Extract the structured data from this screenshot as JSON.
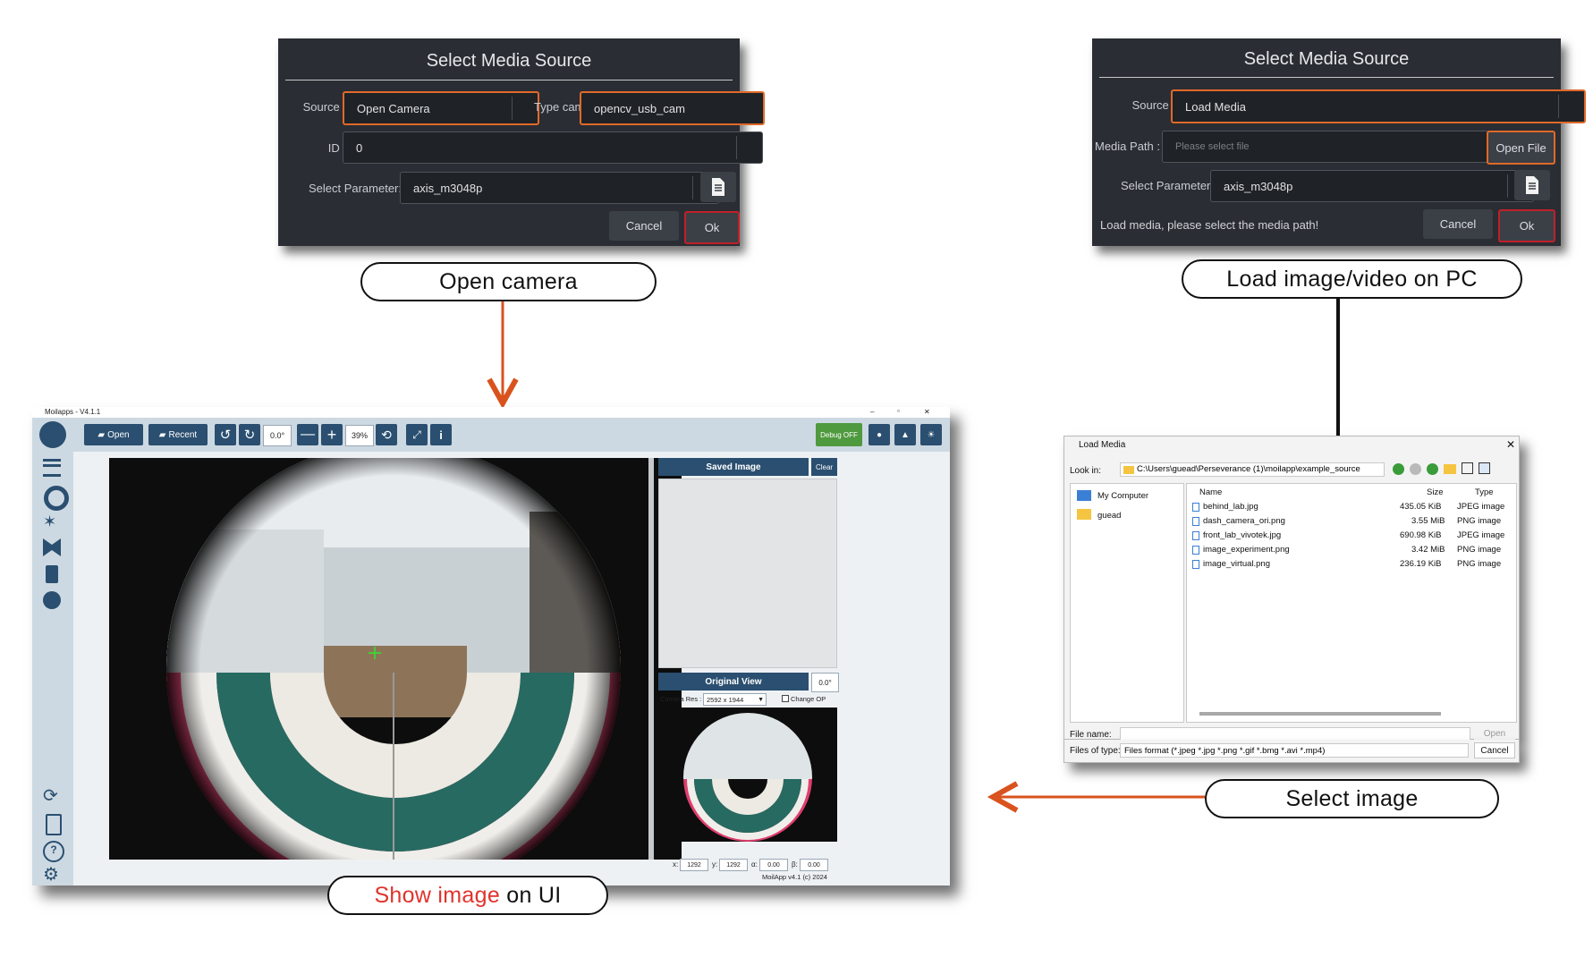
{
  "dialog_camera": {
    "title": "Select Media Source",
    "source_label": "Source :",
    "source_value": "Open Camera",
    "typecam_label": "Type cam:",
    "typecam_value": "opencv_usb_cam",
    "id_label": "ID :",
    "id_value": "0",
    "param_label": "Select Parameter:",
    "param_value": "axis_m3048p",
    "cancel": "Cancel",
    "ok": "Ok"
  },
  "dialog_load": {
    "title": "Select Media Source",
    "source_label": "Source :",
    "source_value": "Load Media",
    "path_label": "Media Path :",
    "path_placeholder": "Please select file",
    "open_file": "Open File",
    "param_label": "Select Parameter:",
    "param_value": "axis_m3048p",
    "message": "Load media, please select the media path!",
    "cancel": "Cancel",
    "ok": "Ok"
  },
  "pills": {
    "open_camera": "Open camera",
    "load": "Load image/video on PC",
    "select": "Select image",
    "show_red": "Show image",
    "show_rest": " on UI"
  },
  "app": {
    "title": "Moilapps - V4.1.1",
    "win_min": "–",
    "win_max": "▫",
    "win_close": "✕",
    "open": "Open",
    "recent": "Recent",
    "rotate_value": "0.0°",
    "zoom_value": "39%",
    "debug": "Debug OFF",
    "saved_image": "Saved Image",
    "clear": "Clear",
    "original_view": "Original View",
    "orig_angle": "0.0°",
    "camera_res_label": "Camera Res :",
    "camera_res_value": "2592 x 1944",
    "change_op": "Change OP",
    "x_label": "x:",
    "x_value": "1292",
    "y_label": "y:",
    "y_value": "1292",
    "alpha_label": "α:",
    "alpha_value": "0.00",
    "beta_label": "β:",
    "beta_value": "0.00",
    "footer": "MoilApp v4.1 (c) 2024"
  },
  "file_dialog": {
    "title": "Load Media",
    "close": "✕",
    "look_in_label": "Look in:",
    "look_in_value": "C:\\Users\\guead\\Perseverance (1)\\moilapp\\example_source",
    "places": [
      "My Computer",
      "guead"
    ],
    "headers": {
      "name": "Name",
      "size": "Size",
      "type": "Type"
    },
    "files": [
      {
        "name": "behind_lab.jpg",
        "size": "435.05 KiB",
        "type": "JPEG image"
      },
      {
        "name": "dash_camera_ori.png",
        "size": "3.55 MiB",
        "type": "PNG image"
      },
      {
        "name": "front_lab_vivotek.jpg",
        "size": "690.98 KiB",
        "type": "JPEG image"
      },
      {
        "name": "image_experiment.png",
        "size": "3.42 MiB",
        "type": "PNG image"
      },
      {
        "name": "image_virtual.png",
        "size": "236.19 KiB",
        "type": "PNG image"
      }
    ],
    "file_name_label": "File name:",
    "files_of_type_label": "Files of type:",
    "files_of_type_value": "Files format (*.jpeg *.jpg *.png *.gif *.bmg *.avi *.mp4)",
    "open": "Open",
    "cancel": "Cancel"
  },
  "colors": {
    "highlight_orange": "#e0692a",
    "highlight_red": "#c0202a",
    "arrow_orange": "#d9531e",
    "app_button": "#2a4f70",
    "debug_green": "#4f9a3e"
  }
}
